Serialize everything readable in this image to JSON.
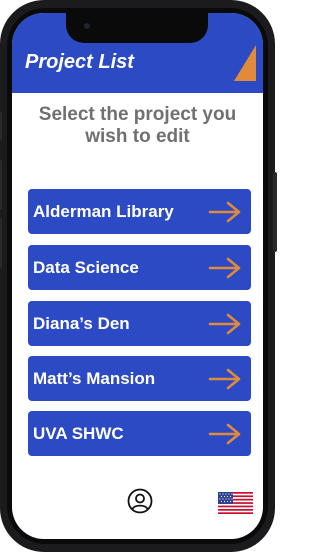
{
  "header": {
    "title": "Project List",
    "brand_color": "#2b4ac4",
    "accent_color": "#e08a3c"
  },
  "prompt": "Select the project you wish to edit",
  "projects": [
    {
      "label": "Alderman Library",
      "icon": "arrow-right-icon"
    },
    {
      "label": "Data Science",
      "icon": "arrow-right-icon"
    },
    {
      "label": "Diana’s Den",
      "icon": "arrow-right-icon"
    },
    {
      "label": "Matt’s Mansion",
      "icon": "arrow-right-icon"
    },
    {
      "label": "UVA SHWC",
      "icon": "arrow-right-icon"
    }
  ],
  "footer": {
    "profile_icon": "user-profile-icon",
    "language_icon": "us-flag-icon"
  }
}
